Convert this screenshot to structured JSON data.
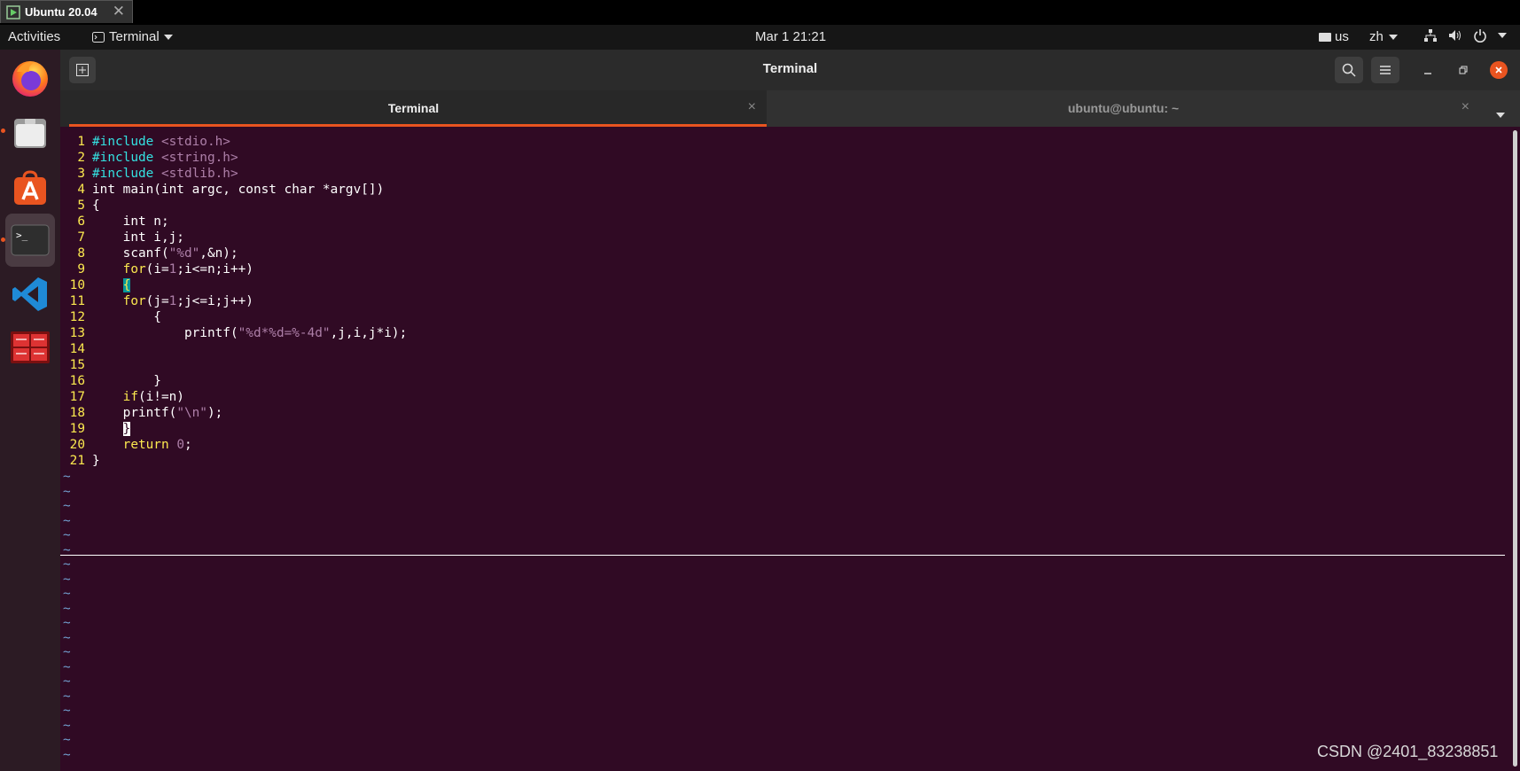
{
  "vm": {
    "tab_title": "Ubuntu 20.04",
    "close_glyph": "✕"
  },
  "top_panel": {
    "activities": "Activities",
    "app_name": "Terminal",
    "clock": "Mar 1  21:21",
    "keyboard": "us",
    "input_method": "zh"
  },
  "dock": {
    "items": [
      {
        "name": "firefox-icon",
        "running": false
      },
      {
        "name": "files-icon",
        "running": true
      },
      {
        "name": "software-center-icon",
        "running": false
      },
      {
        "name": "terminal-icon",
        "running": true,
        "active": true
      },
      {
        "name": "vscode-icon",
        "running": false
      },
      {
        "name": "remote-desktop-icon",
        "running": false
      }
    ]
  },
  "window": {
    "title": "Terminal",
    "tabs": [
      {
        "label": "Terminal",
        "active": true,
        "close": "×"
      },
      {
        "label": "ubuntu@ubuntu: ~",
        "active": false,
        "close": "×"
      }
    ]
  },
  "editor": {
    "lines": [
      {
        "n": "1",
        "segs": [
          [
            "pp",
            "#include "
          ],
          [
            "str",
            "<stdio.h>"
          ]
        ]
      },
      {
        "n": "2",
        "segs": [
          [
            "pp",
            "#include "
          ],
          [
            "str",
            "<string.h>"
          ]
        ]
      },
      {
        "n": "3",
        "segs": [
          [
            "pp",
            "#include "
          ],
          [
            "str",
            "<stdlib.h>"
          ]
        ]
      },
      {
        "n": "4",
        "segs": [
          [
            "",
            "int main(int argc, const char *argv[])"
          ]
        ]
      },
      {
        "n": "5",
        "segs": [
          [
            "",
            "{"
          ]
        ]
      },
      {
        "n": "6",
        "segs": [
          [
            "",
            "    int n;"
          ]
        ]
      },
      {
        "n": "7",
        "segs": [
          [
            "",
            "    int i,j;"
          ]
        ]
      },
      {
        "n": "8",
        "segs": [
          [
            "",
            "    scanf("
          ],
          [
            "str",
            "\"%d\""
          ],
          [
            "",
            ",&n);"
          ]
        ]
      },
      {
        "n": "9",
        "segs": [
          [
            "kw",
            "    for"
          ],
          [
            "",
            "(i="
          ],
          [
            "str",
            "1"
          ],
          [
            "",
            ";i<=n;i++)"
          ]
        ]
      },
      {
        "n": "10",
        "segs": [
          [
            "",
            "    "
          ],
          [
            "hl",
            "{"
          ]
        ]
      },
      {
        "n": "11",
        "segs": [
          [
            "kw",
            "    for"
          ],
          [
            "",
            "(j="
          ],
          [
            "str",
            "1"
          ],
          [
            "",
            ";j<=i;j++)"
          ]
        ]
      },
      {
        "n": "12",
        "segs": [
          [
            "",
            "        {"
          ]
        ]
      },
      {
        "n": "13",
        "segs": [
          [
            "",
            "            printf("
          ],
          [
            "str",
            "\"%d*%d=%-4d\""
          ],
          [
            "",
            ",j,i,j*i);"
          ]
        ]
      },
      {
        "n": "14",
        "segs": [
          [
            "",
            ""
          ]
        ]
      },
      {
        "n": "15",
        "segs": [
          [
            "",
            ""
          ]
        ]
      },
      {
        "n": "16",
        "segs": [
          [
            "",
            "        }"
          ]
        ]
      },
      {
        "n": "17",
        "segs": [
          [
            "kw",
            "    if"
          ],
          [
            "",
            "(i!=n)"
          ]
        ]
      },
      {
        "n": "18",
        "segs": [
          [
            "",
            "    printf("
          ],
          [
            "str",
            "\"\\n\""
          ],
          [
            "",
            ");"
          ]
        ]
      },
      {
        "n": "19",
        "segs": [
          [
            "",
            "    "
          ],
          [
            "cur",
            "}"
          ]
        ]
      },
      {
        "n": "20",
        "segs": [
          [
            "kw",
            "    return "
          ],
          [
            "str",
            "0"
          ],
          [
            "",
            ";"
          ]
        ]
      },
      {
        "n": "21",
        "segs": [
          [
            "",
            "}"
          ]
        ]
      }
    ],
    "tilde_count": 20,
    "tilde_char": "~"
  },
  "watermark": "CSDN @2401_83238851",
  "colors": {
    "accent": "#e95420",
    "terminal_bg": "#300a24"
  }
}
